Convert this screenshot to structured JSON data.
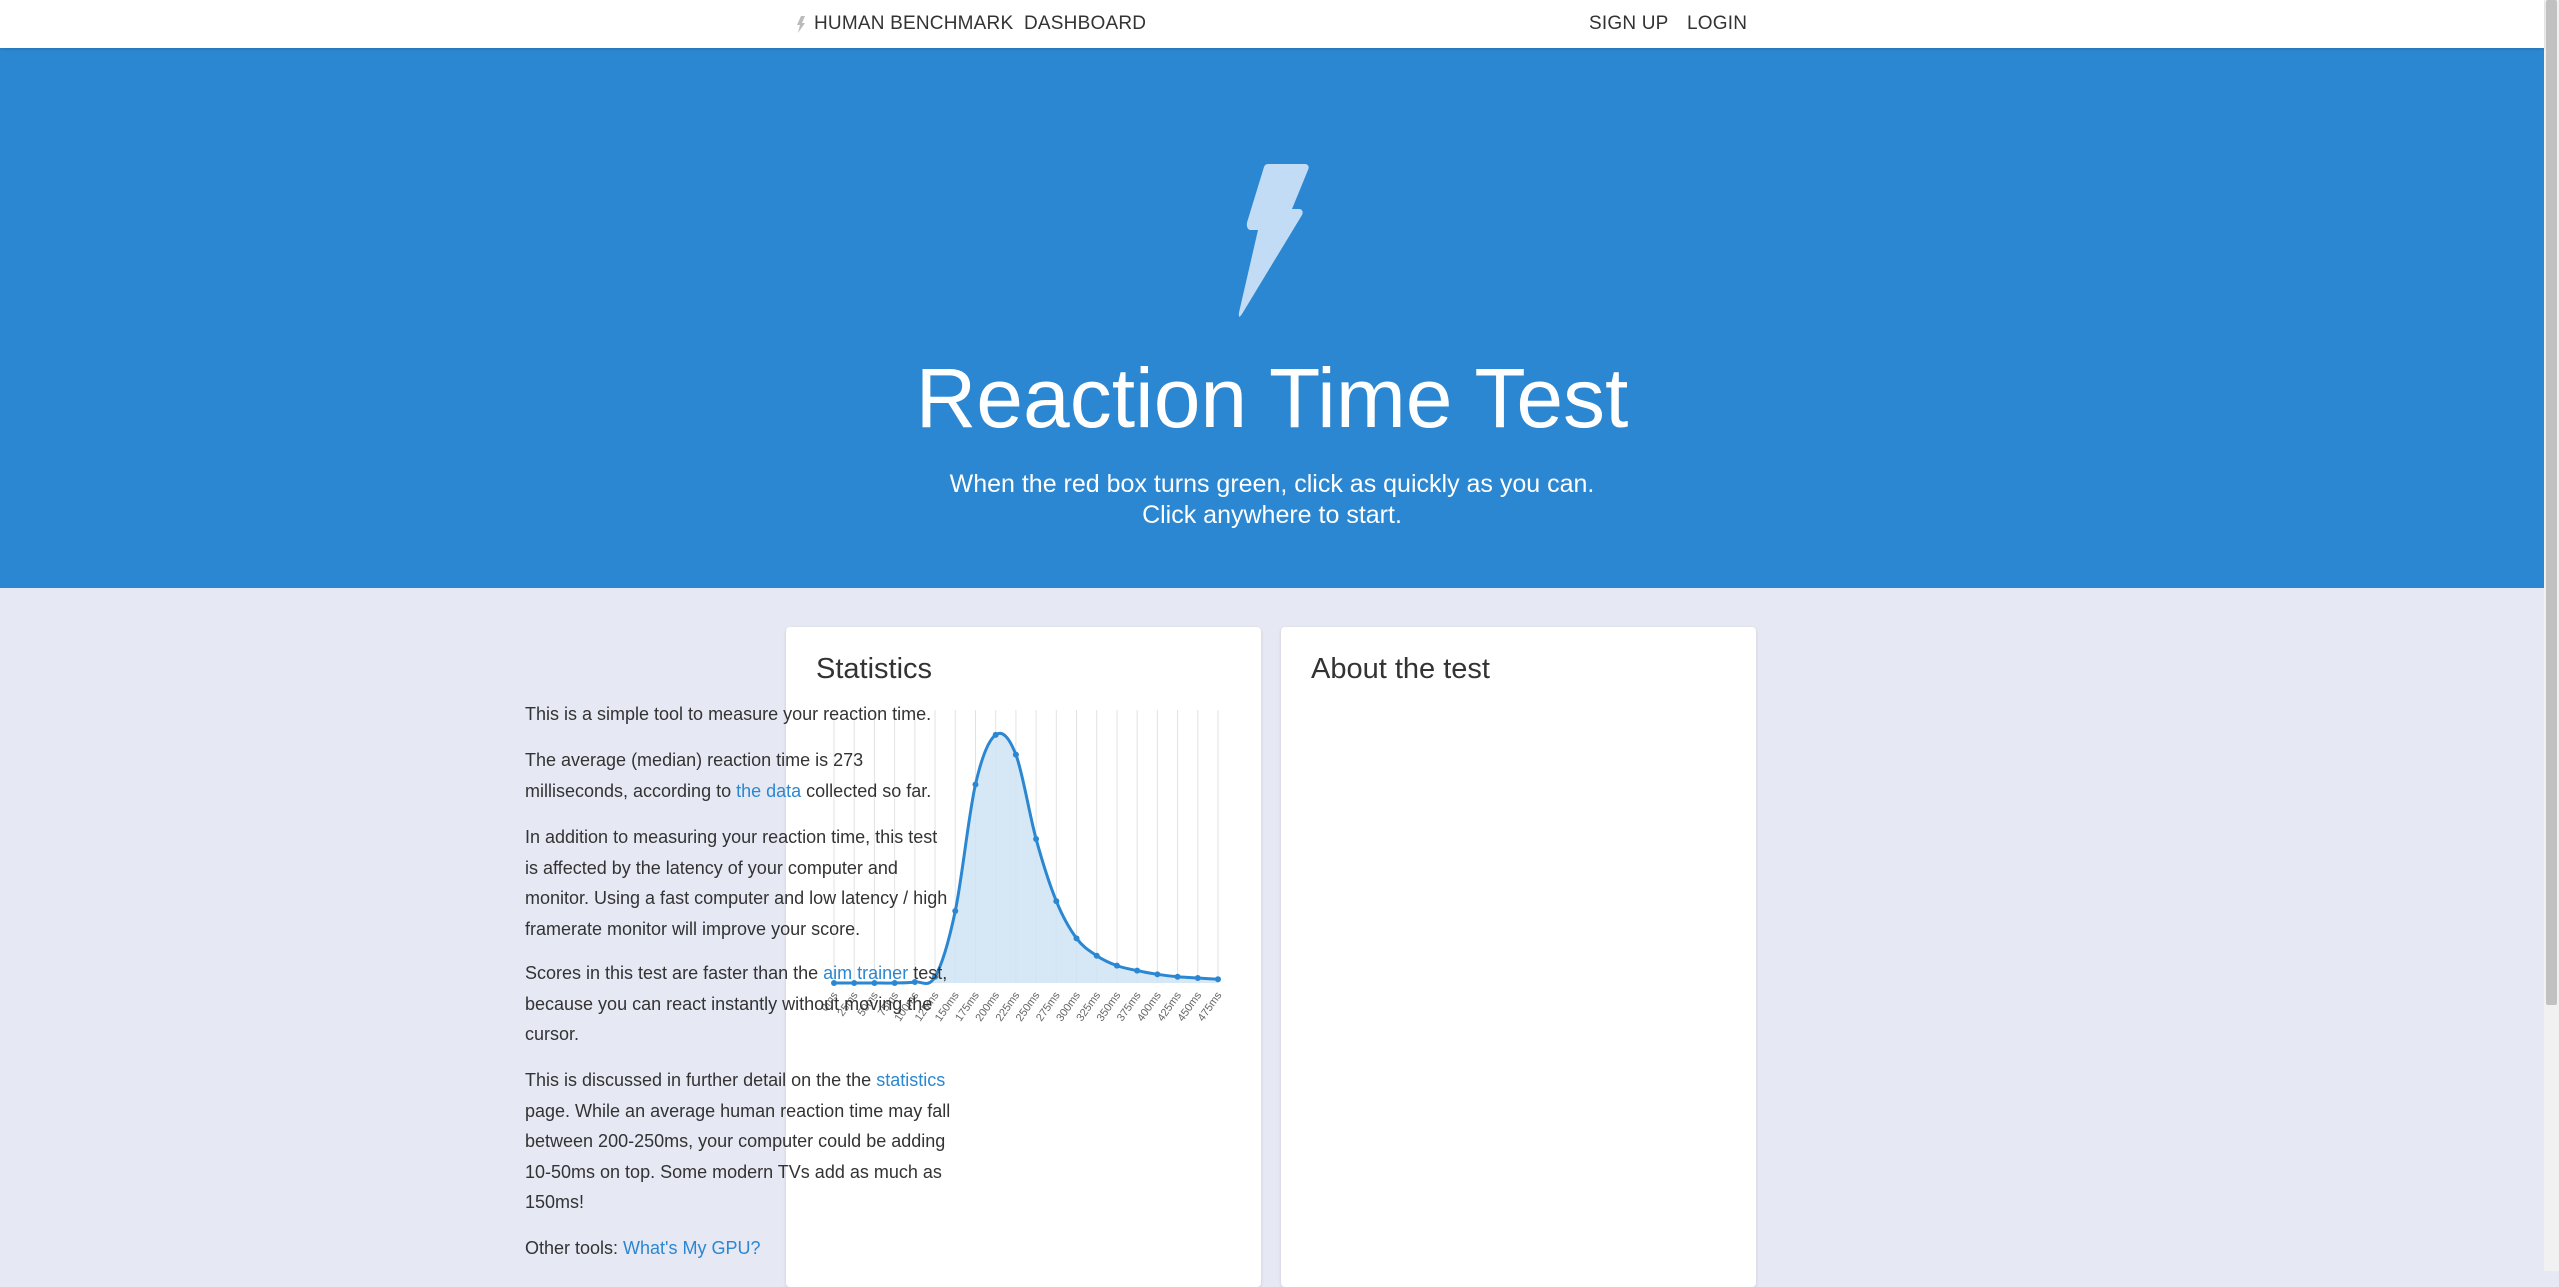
{
  "nav": {
    "brand": "HUMAN BENCHMARK",
    "dashboard": "DASHBOARD",
    "signup": "SIGN UP",
    "login": "LOGIN"
  },
  "hero": {
    "title": "Reaction Time Test",
    "line1": "When the red box turns green, click as quickly as you can.",
    "line2": "Click anywhere to start.",
    "background": "#2b87d1"
  },
  "stats": {
    "title": "Statistics"
  },
  "about": {
    "title": "About the test",
    "p1": "This is a simple tool to measure your reaction time.",
    "p2a": "The average (median) reaction time is 273 milliseconds, according to ",
    "p2_link": "the data",
    "p2b": " collected so far.",
    "p3": "In addition to measuring your reaction time, this test is affected by the latency of your computer and monitor. Using a fast computer and low latency / high framerate monitor will improve your score.",
    "p4a": "Scores in this test are faster than the ",
    "p4_link": "aim trainer",
    "p4b": " test, because you can react instantly without moving the cursor.",
    "p5a": "This is discussed in further detail on the the ",
    "p5_link": "statistics",
    "p5b": " page. While an average human reaction time may fall between 200-250ms, your computer could be adding 10-50ms on top. Some modern TVs add as much as 150ms!",
    "p6a": "Other tools: ",
    "p6_link": "What's My GPU?"
  },
  "chart_data": {
    "type": "area",
    "x": [
      "0ms",
      "25ms",
      "50ms",
      "75ms",
      "100ms",
      "125ms",
      "150ms",
      "175ms",
      "200ms",
      "225ms",
      "250ms",
      "275ms",
      "300ms",
      "325ms",
      "350ms",
      "375ms",
      "400ms",
      "425ms",
      "450ms",
      "475ms"
    ],
    "x_values": [
      0,
      25,
      50,
      75,
      100,
      125,
      150,
      175,
      200,
      225,
      250,
      275,
      300,
      325,
      350,
      375,
      400,
      425,
      450,
      475
    ],
    "y": [
      0,
      0,
      0,
      0,
      0.4,
      2.5,
      29,
      80,
      100,
      92,
      58,
      33,
      18,
      11,
      7,
      5,
      3.5,
      2.5,
      2,
      1.5
    ],
    "ylim": [
      0,
      110
    ],
    "grid": true,
    "line_color": "#2b87d1",
    "fill_color": "#cfe3f5"
  }
}
